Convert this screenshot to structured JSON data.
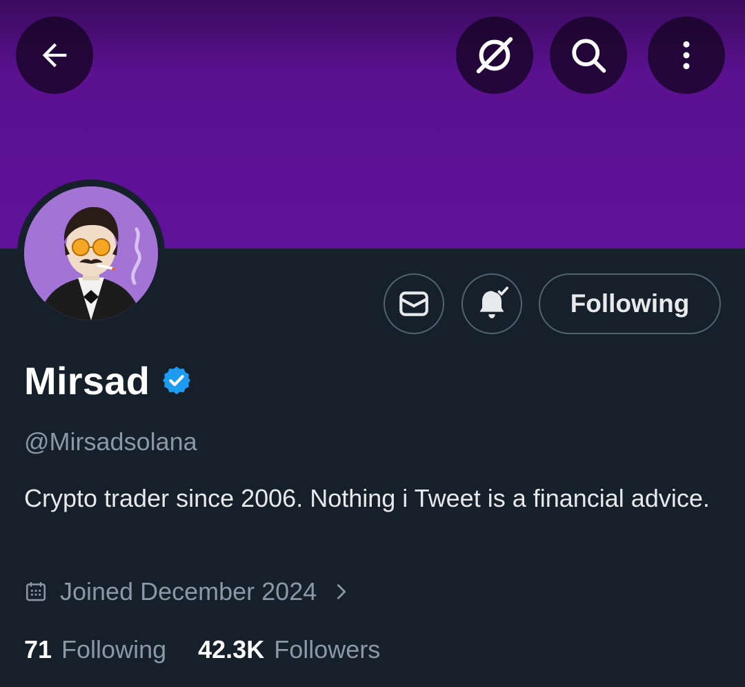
{
  "header": {
    "back_icon": "arrow-left-icon",
    "grok_icon": "grok-icon",
    "search_icon": "search-icon",
    "more_icon": "more-vertical-icon",
    "banner_color": "#5b1190"
  },
  "profile": {
    "display_name": "Mirsad",
    "verified_icon": "verified-badge-icon",
    "verified_color": "#1d9bf0",
    "handle": "@Mirsadsolana",
    "bio": "Crypto trader since 2006. Nothing i Tweet is a financial advice.",
    "joined": "Joined December 2024"
  },
  "actions": {
    "message_icon": "envelope-icon",
    "notifications_icon": "bell-check-icon",
    "follow_label": "Following"
  },
  "stats": {
    "following_count": "71",
    "following_label": "Following",
    "followers_count": "42.3K",
    "followers_label": "Followers"
  }
}
